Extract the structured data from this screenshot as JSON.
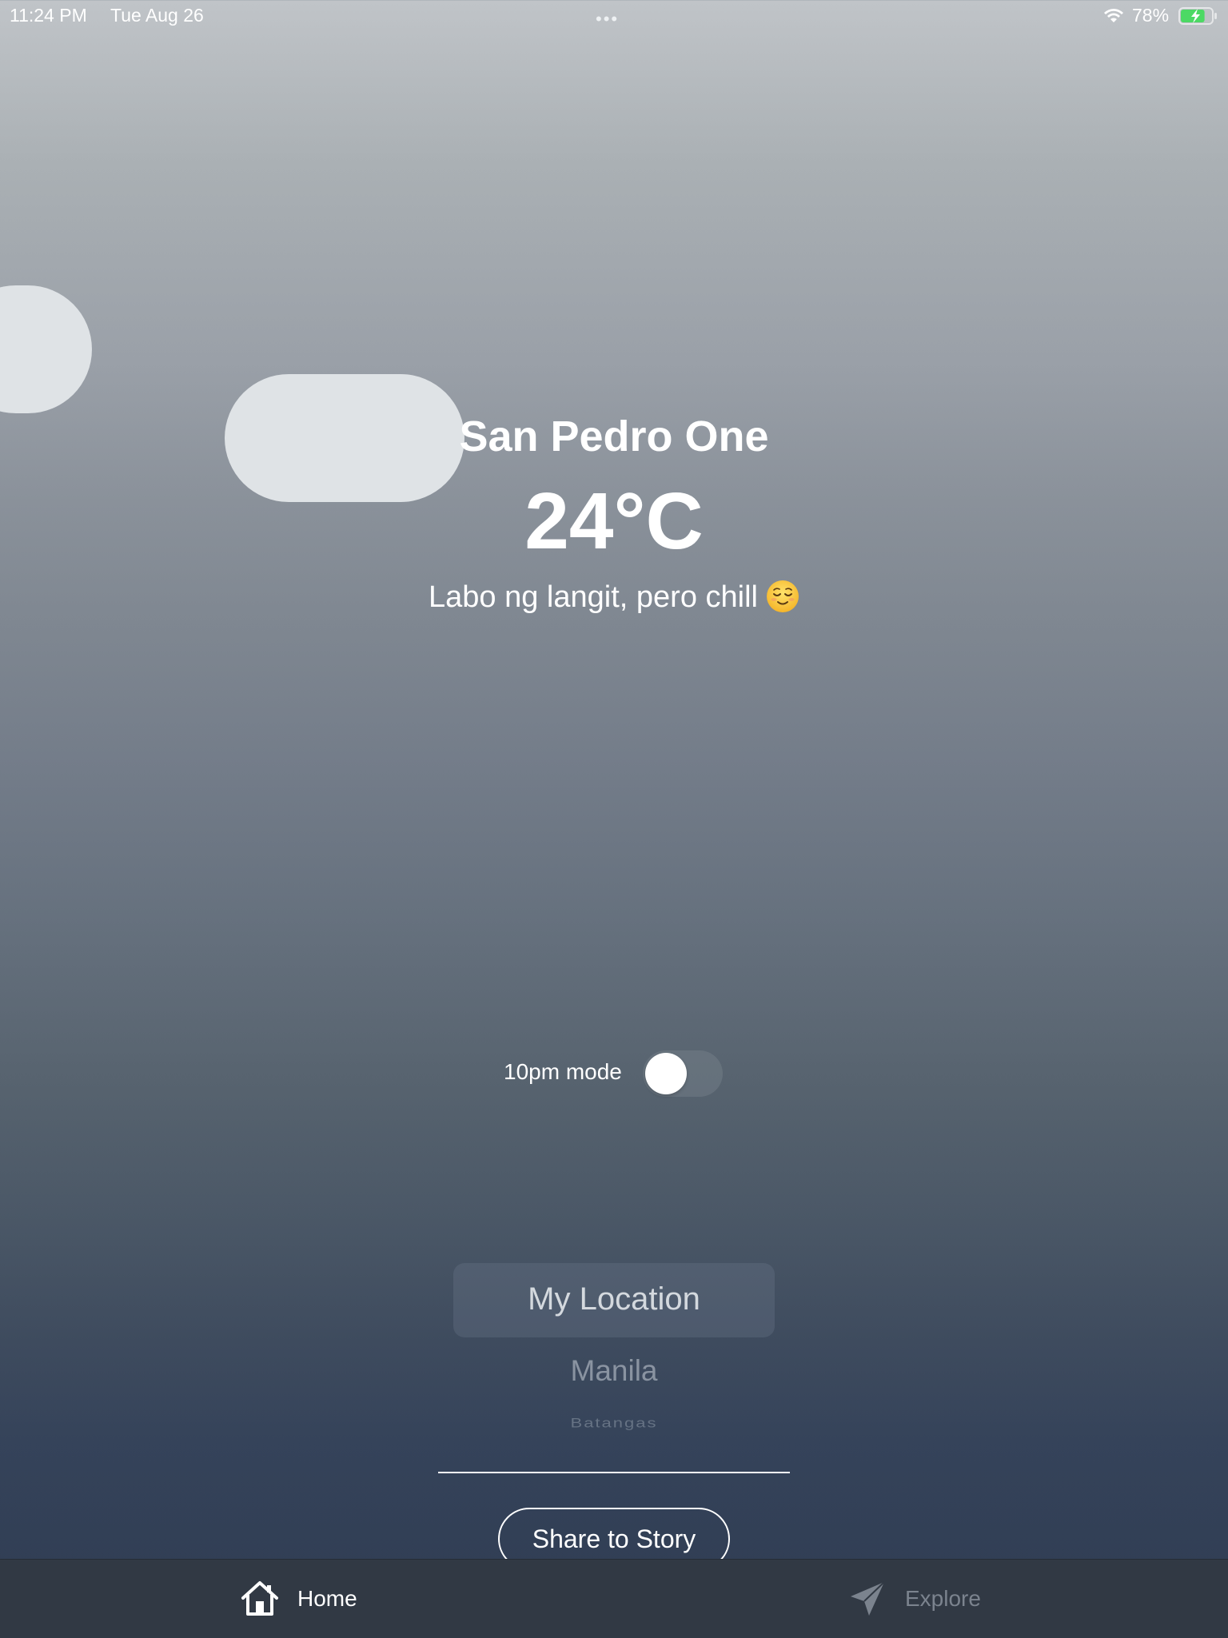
{
  "status_bar": {
    "time": "11:24 PM",
    "date": "Tue Aug 26",
    "dots": "•••",
    "battery_percent": "78%",
    "wifi_icon": "wifi-icon",
    "battery_icon": "battery-charging-icon",
    "battery_level": 0.78
  },
  "weather": {
    "city": "San Pedro One",
    "temperature": "24°C",
    "description": "Labo ng langit, pero chill",
    "description_emoji": "relieved-face-emoji"
  },
  "ten_pm_mode": {
    "label": "10pm mode",
    "enabled": false
  },
  "location_picker": {
    "items": [
      "My Location",
      "Manila",
      "Batangas"
    ],
    "selected": "My Location"
  },
  "share_button": {
    "label": "Share to Story"
  },
  "tab_bar": {
    "tabs": [
      {
        "label": "Home",
        "icon": "house-icon",
        "active": true
      },
      {
        "label": "Explore",
        "icon": "paper-plane-icon",
        "active": false
      }
    ]
  },
  "colors": {
    "gradient_top": "#c0c4c8",
    "gradient_bottom": "#2f3c52",
    "cloud": "#dfe3e6",
    "tabbar_bg": "#313944",
    "tab_inactive": "#7b838e",
    "battery_green": "#4cd964"
  }
}
